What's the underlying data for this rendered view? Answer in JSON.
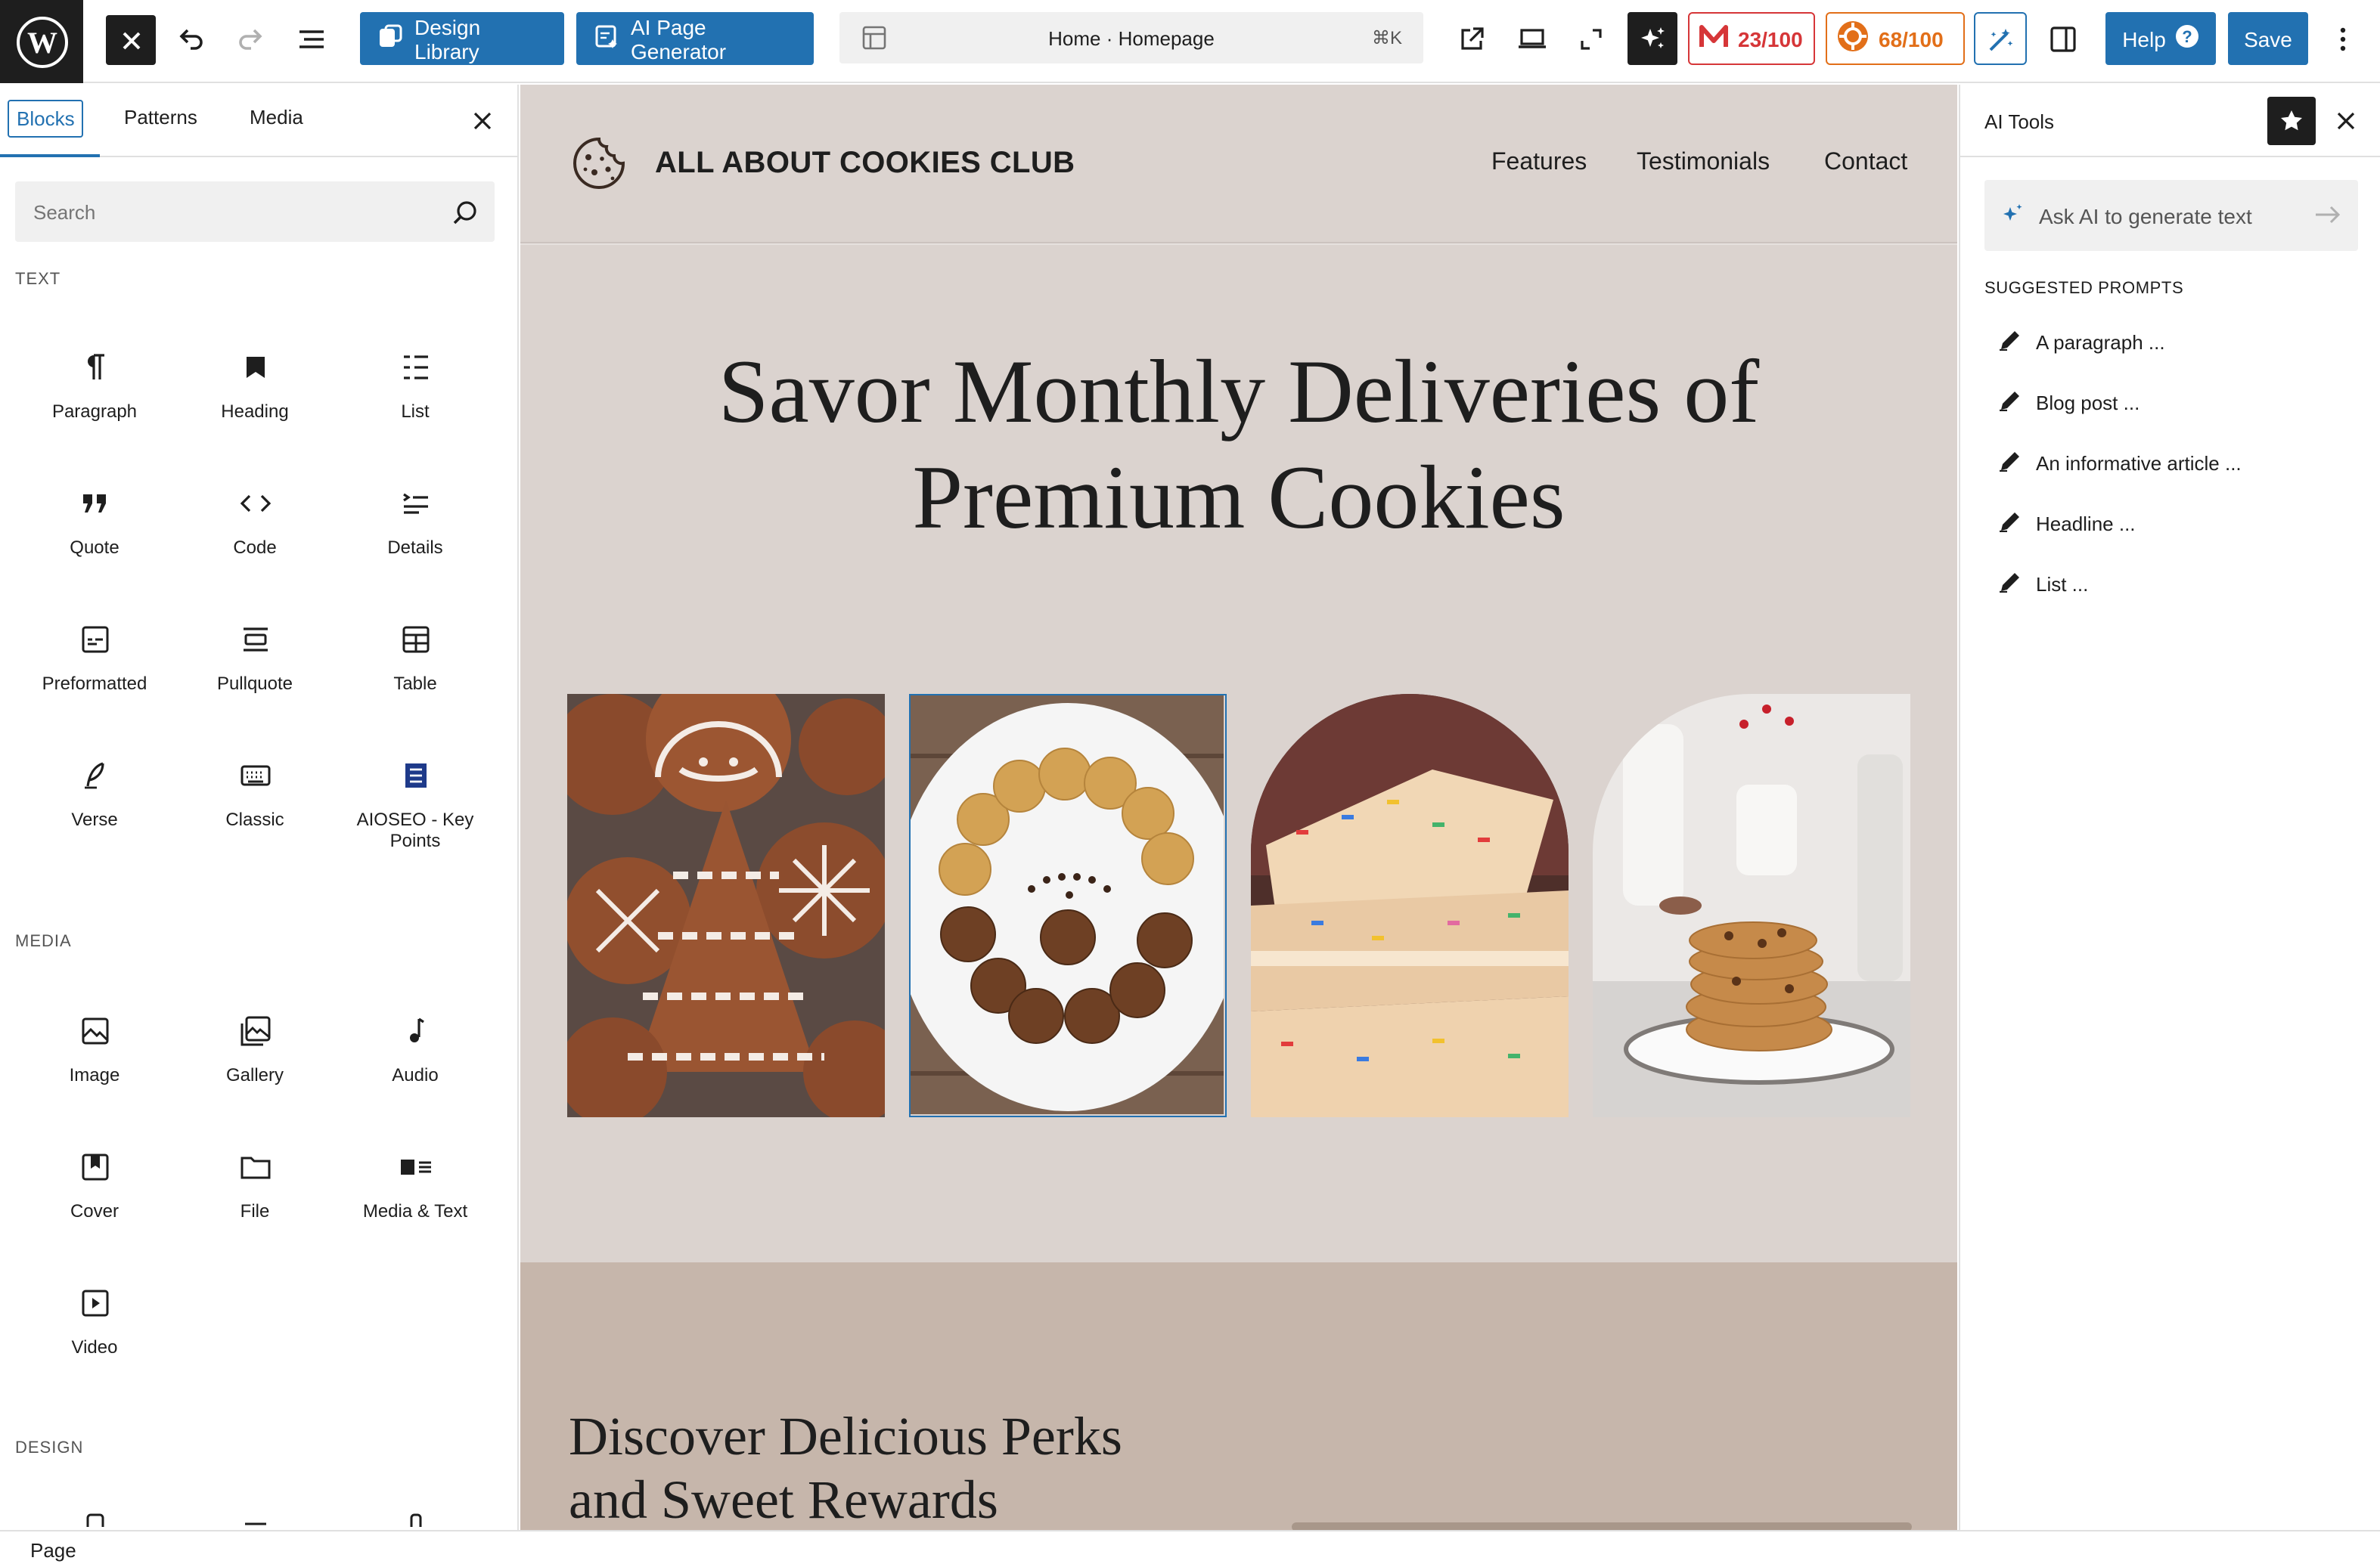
{
  "toolbar": {
    "design_library": "Design Library",
    "ai_page_generator": "AI Page Generator",
    "command_title": "Home · Homepage",
    "command_shortcut": "⌘K",
    "seo_score": "23/100",
    "headline_score": "68/100",
    "help": "Help",
    "save": "Save",
    "colors": {
      "primary": "#2271b1",
      "seo": "#d63638",
      "headline": "#e26f19"
    }
  },
  "inserter": {
    "tabs": [
      "Blocks",
      "Patterns",
      "Media"
    ],
    "search_placeholder": "Search",
    "categories": {
      "text": "TEXT",
      "media": "MEDIA",
      "design": "DESIGN"
    },
    "text_blocks": [
      {
        "label": "Paragraph",
        "icon": "paragraph-icon"
      },
      {
        "label": "Heading",
        "icon": "heading-icon"
      },
      {
        "label": "List",
        "icon": "list-icon"
      },
      {
        "label": "Quote",
        "icon": "quote-icon"
      },
      {
        "label": "Code",
        "icon": "code-icon"
      },
      {
        "label": "Details",
        "icon": "details-icon"
      },
      {
        "label": "Preformatted",
        "icon": "preformatted-icon"
      },
      {
        "label": "Pullquote",
        "icon": "pullquote-icon"
      },
      {
        "label": "Table",
        "icon": "table-icon"
      },
      {
        "label": "Verse",
        "icon": "verse-icon"
      },
      {
        "label": "Classic",
        "icon": "classic-icon"
      },
      {
        "label": "AIOSEO - Key Points",
        "icon": "key-points-icon"
      }
    ],
    "media_blocks": [
      {
        "label": "Image",
        "icon": "image-icon"
      },
      {
        "label": "Gallery",
        "icon": "gallery-icon"
      },
      {
        "label": "Audio",
        "icon": "audio-icon"
      },
      {
        "label": "Cover",
        "icon": "cover-icon"
      },
      {
        "label": "File",
        "icon": "file-icon"
      },
      {
        "label": "Media & Text",
        "icon": "media-text-icon"
      },
      {
        "label": "Video",
        "icon": "video-icon"
      }
    ]
  },
  "canvas": {
    "site_title": "ALL ABOUT COOKIES CLUB",
    "nav": [
      "Features",
      "Testimonials",
      "Contact"
    ],
    "hero_title": "Savor Monthly Deliveries of Premium Cookies",
    "section2_title": "Discover Delicious Perks and Sweet Rewards"
  },
  "ai_tools": {
    "title": "AI Tools",
    "input_placeholder": "Ask AI to generate text",
    "suggested_heading": "SUGGESTED PROMPTS",
    "prompts": [
      "A paragraph ...",
      "Blog post ...",
      "An informative article ...",
      "Headline ...",
      "List ..."
    ]
  },
  "footer": {
    "breadcrumb": "Page"
  }
}
